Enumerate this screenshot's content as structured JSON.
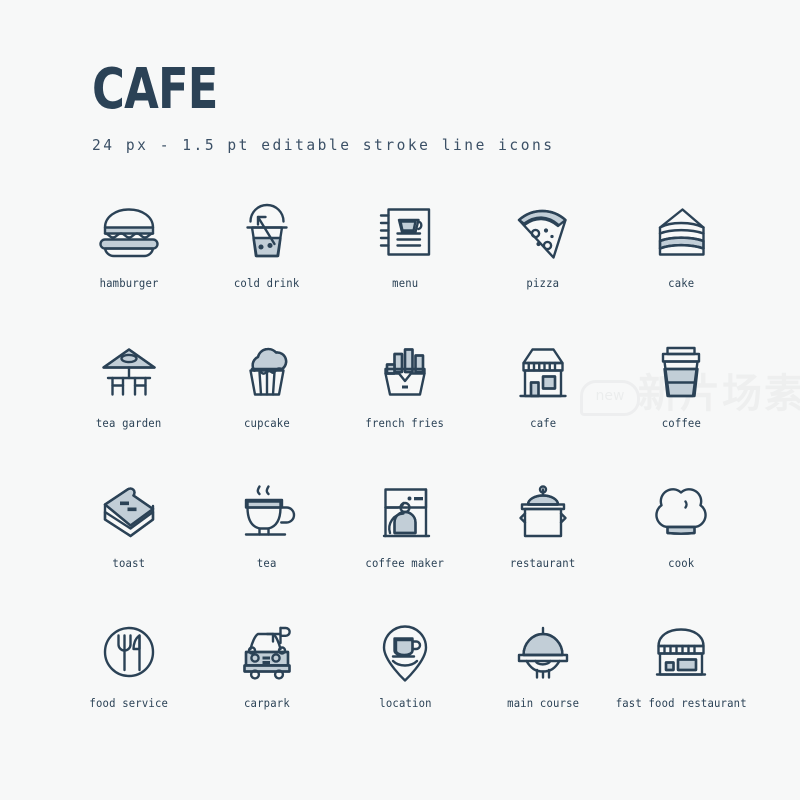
{
  "header": {
    "title": "CAFE",
    "subtitle": "24 px - 1.5 pt editable stroke line icons"
  },
  "watermark": {
    "badge": "new",
    "text": "新片场素材"
  },
  "colors": {
    "background": "#f7f8f8",
    "stroke": "#2b4256",
    "fill": "#c2ced7",
    "watermark": "#dadcdd"
  },
  "grid": {
    "columns": 5,
    "rows": 4,
    "icon_size_px": 24,
    "stroke_pt": 1.5
  },
  "icons": [
    {
      "id": "hamburger",
      "label": "hamburger",
      "row": 1,
      "col": 1
    },
    {
      "id": "cold-drink",
      "label": "cold drink",
      "row": 1,
      "col": 2
    },
    {
      "id": "menu",
      "label": "menu",
      "row": 1,
      "col": 3
    },
    {
      "id": "pizza",
      "label": "pizza",
      "row": 1,
      "col": 4
    },
    {
      "id": "cake",
      "label": "cake",
      "row": 1,
      "col": 5
    },
    {
      "id": "tea-garden",
      "label": "tea garden",
      "row": 2,
      "col": 1
    },
    {
      "id": "cupcake",
      "label": "cupcake",
      "row": 2,
      "col": 2
    },
    {
      "id": "french-fries",
      "label": "french fries",
      "row": 2,
      "col": 3
    },
    {
      "id": "cafe",
      "label": "cafe",
      "row": 2,
      "col": 4
    },
    {
      "id": "coffee",
      "label": "coffee",
      "row": 2,
      "col": 5
    },
    {
      "id": "toast",
      "label": "toast",
      "row": 3,
      "col": 1
    },
    {
      "id": "tea",
      "label": "tea",
      "row": 3,
      "col": 2
    },
    {
      "id": "coffee-maker",
      "label": "coffee maker",
      "row": 3,
      "col": 3
    },
    {
      "id": "restaurant",
      "label": "restaurant",
      "row": 3,
      "col": 4
    },
    {
      "id": "cook",
      "label": "cook",
      "row": 3,
      "col": 5
    },
    {
      "id": "food-service",
      "label": "food service",
      "row": 4,
      "col": 1
    },
    {
      "id": "carpark",
      "label": "carpark",
      "row": 4,
      "col": 2
    },
    {
      "id": "location",
      "label": "location",
      "row": 4,
      "col": 3
    },
    {
      "id": "main-course",
      "label": "main course",
      "row": 4,
      "col": 4
    },
    {
      "id": "fast-food-restaurant",
      "label": "fast food restaurant",
      "row": 4,
      "col": 5
    }
  ]
}
